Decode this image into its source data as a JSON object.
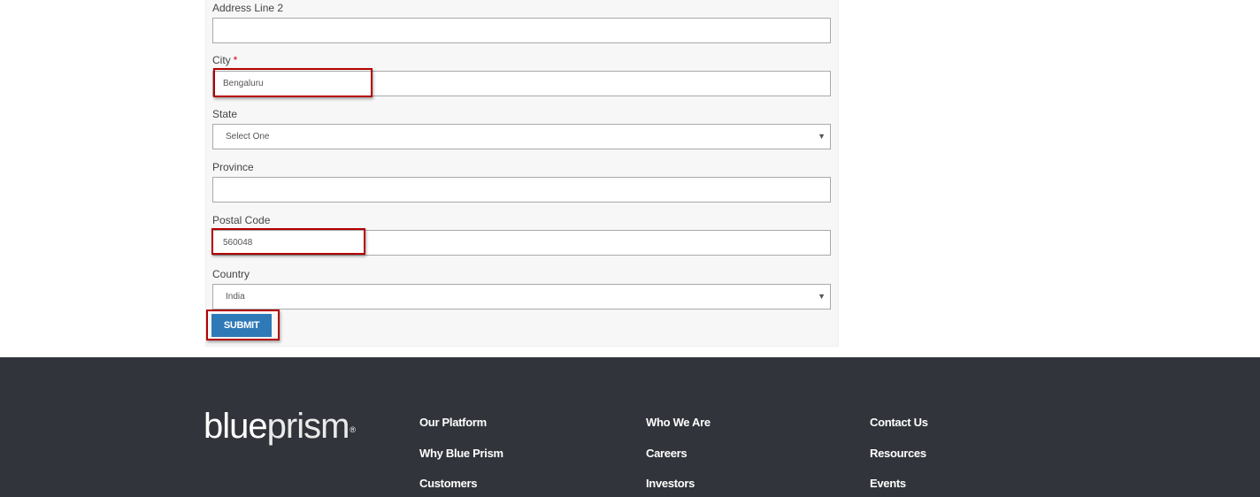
{
  "form": {
    "address_line2_label": "Address Line 2",
    "address_line2_value": "",
    "city_label": "City",
    "city_required_mark": "*",
    "city_value": "Bengaluru",
    "state_label": "State",
    "state_value": "Select One",
    "province_label": "Province",
    "province_value": "",
    "postal_code_label": "Postal Code",
    "postal_code_value": "560048",
    "country_label": "Country",
    "country_value": "India",
    "submit_label": "SUBMIT",
    "select_arrow": "▼"
  },
  "footer": {
    "logo_part1": "blue",
    "logo_part2": "prism",
    "logo_reg": "®",
    "col1": [
      "Our Platform",
      "Why Blue Prism",
      "Customers"
    ],
    "col2": [
      "Who We Are",
      "Careers",
      "Investors"
    ],
    "col3": [
      "Contact Us",
      "Resources",
      "Events"
    ]
  },
  "colors": {
    "highlight": "#b40000",
    "submit_bg": "#2f79b7",
    "footer_bg": "#31343a",
    "required": "#d0021b"
  }
}
